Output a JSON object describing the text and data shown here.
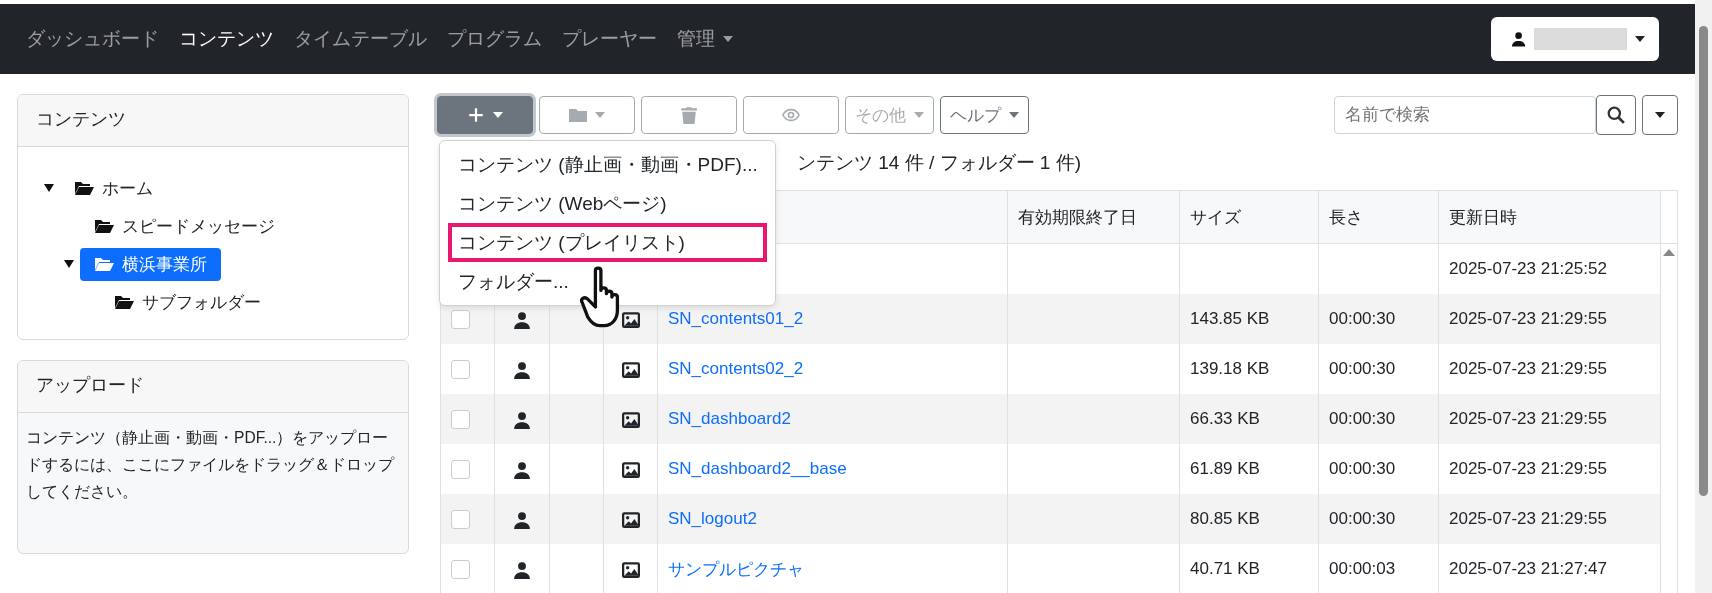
{
  "navbar": {
    "items": [
      {
        "label": "ダッシュボード",
        "selected": false,
        "caret": false
      },
      {
        "label": "コンテンツ",
        "selected": true,
        "caret": false
      },
      {
        "label": "タイムテーブル",
        "selected": false,
        "caret": false
      },
      {
        "label": "プログラム",
        "selected": false,
        "caret": false
      },
      {
        "label": "プレーヤー",
        "selected": false,
        "caret": false
      },
      {
        "label": "管理",
        "selected": false,
        "caret": true
      }
    ]
  },
  "sidebar": {
    "title": "コンテンツ",
    "tree": [
      {
        "label": "ホーム",
        "expanded": true,
        "selected": false,
        "children": [
          {
            "label": "スピードメッセージ",
            "selected": false
          },
          {
            "label": "横浜事業所",
            "expanded": true,
            "selected": true,
            "children": [
              {
                "label": "サブフォルダー",
                "selected": false
              }
            ]
          }
        ]
      }
    ]
  },
  "upload": {
    "title": "アップロード",
    "text": "コンテンツ（静止画・動画・PDF...）をアップロードするには、ここにファイルをドラッグ＆ドロップしてください。"
  },
  "toolbar": [
    {
      "kind": "add",
      "caret": true,
      "expanded": true,
      "disabled": false
    },
    {
      "kind": "folder",
      "caret": true,
      "expanded": false,
      "disabled": true
    },
    {
      "kind": "delete",
      "caret": false,
      "expanded": false,
      "disabled": true
    },
    {
      "kind": "preview",
      "caret": false,
      "expanded": false,
      "disabled": true
    },
    {
      "kind": "text",
      "label": "その他",
      "caret": true,
      "expanded": false,
      "disabled": true
    },
    {
      "kind": "text",
      "label": "ヘルプ",
      "caret": true,
      "expanded": false,
      "disabled": false
    }
  ],
  "add_menu": [
    {
      "label": "コンテンツ (静止画・動画・PDF)...",
      "highlighted": false
    },
    {
      "label": "コンテンツ (Webページ)",
      "highlighted": false
    },
    {
      "label": "コンテンツ (プレイリスト)",
      "highlighted": true
    },
    {
      "label": "フォルダー...",
      "highlighted": false
    }
  ],
  "search": {
    "placeholder": "名前で検索"
  },
  "count_text": "ンテンツ 14 件 / フォルダー 1 件)",
  "table": {
    "columns": [
      "有効期限終了日",
      "サイズ",
      "長さ",
      "更新日時"
    ],
    "rows": [
      {
        "kind": "folder",
        "updated": "2025-07-23 21:25:52"
      },
      {
        "kind": "image",
        "checked": false,
        "name": "SN_contents01_2",
        "size": "143.85 KB",
        "length": "00:00:30",
        "updated": "2025-07-23 21:29:55"
      },
      {
        "kind": "image",
        "checked": false,
        "name": "SN_contents02_2",
        "size": "139.18 KB",
        "length": "00:00:30",
        "updated": "2025-07-23 21:29:55"
      },
      {
        "kind": "image",
        "checked": false,
        "name": "SN_dashboard2",
        "size": "66.33 KB",
        "length": "00:00:30",
        "updated": "2025-07-23 21:29:55"
      },
      {
        "kind": "image",
        "checked": false,
        "name": "SN_dashboard2__base",
        "size": "61.89 KB",
        "length": "00:00:30",
        "updated": "2025-07-23 21:29:55"
      },
      {
        "kind": "image",
        "checked": false,
        "name": "SN_logout2",
        "size": "80.85 KB",
        "length": "00:00:30",
        "updated": "2025-07-23 21:29:55"
      },
      {
        "kind": "image",
        "checked": false,
        "name": "サンプルピクチャ",
        "size": "40.71 KB",
        "length": "00:00:03",
        "updated": "2025-07-23 21:27:47"
      }
    ]
  }
}
